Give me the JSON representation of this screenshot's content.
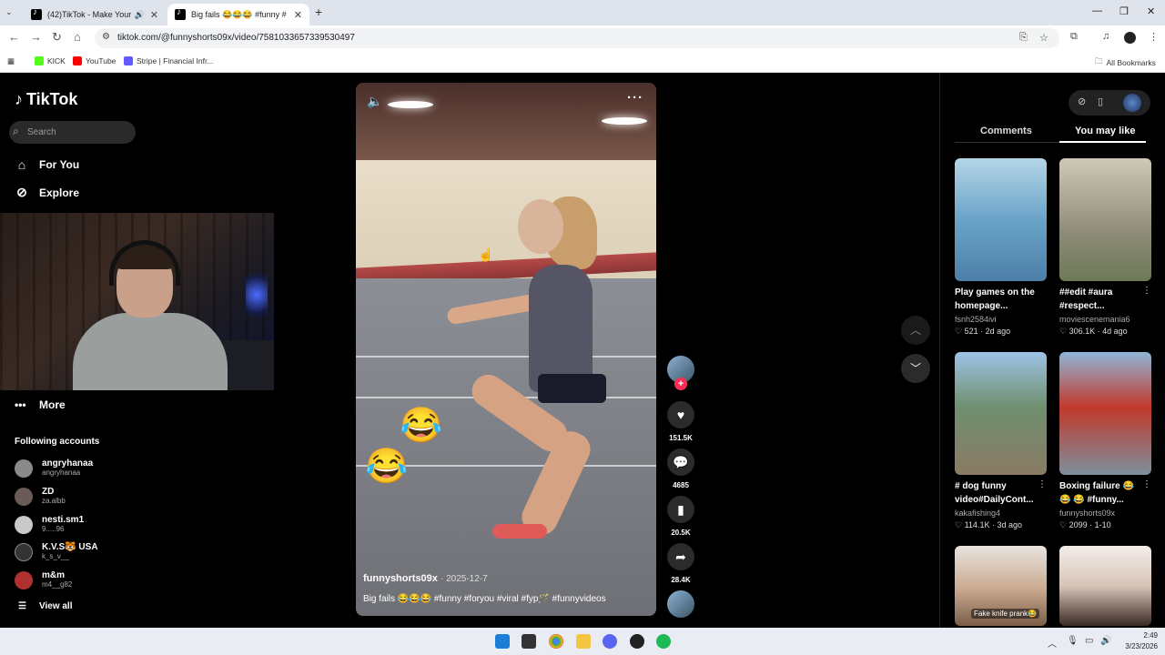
{
  "browser": {
    "tabs": [
      {
        "title": "(42)TikTok - Make Your Day",
        "active": false
      },
      {
        "title": "Big fails 😂😂😂 #funny #",
        "active": true
      }
    ],
    "url": "tiktok.com/@funnyshorts09x/video/7581033657339530497",
    "bookmarks": [
      {
        "label": "KICK",
        "color": "#53fc18"
      },
      {
        "label": "YouTube",
        "color": "#ff0000"
      },
      {
        "label": "Stripe | Financial Infr...",
        "color": "#635bff"
      }
    ],
    "all_bookmarks": "All Bookmarks"
  },
  "sidebar": {
    "logo": "TikTok",
    "search_placeholder": "Search",
    "nav": [
      {
        "label": "For You",
        "icon": "home-icon"
      },
      {
        "label": "Explore",
        "icon": "compass-icon"
      }
    ],
    "more": "More",
    "following_title": "Following accounts",
    "accounts": [
      {
        "name": "angryhanaa",
        "handle": "angryhanaa"
      },
      {
        "name": "ZD",
        "handle": "za.albb"
      },
      {
        "name": "nesti.sm1",
        "handle": "9.....96"
      },
      {
        "name": "K.V.S🐯 USA",
        "handle": "k_s_v__"
      },
      {
        "name": "m&m",
        "handle": "m4__g82"
      }
    ],
    "view_all": "View all"
  },
  "video": {
    "author": "funnyshorts09x",
    "date": "· 2025-12-7",
    "caption": "Big fails 😂😂😂 #funny #foryou #viral #fyp🪄 #funnyvideos",
    "likes": "151.5K",
    "comments": "4685",
    "saves": "20.5K",
    "shares": "28.4K"
  },
  "right_panel": {
    "tabs": [
      "Comments",
      "You may like"
    ],
    "active_tab": "You may like",
    "cards": [
      {
        "title": "Play games on the homepage...",
        "author": "fsnh2584ivi",
        "likes": "521",
        "age": "2d ago"
      },
      {
        "title": "##edit #aura #respect...",
        "author": "moviescenemania6",
        "likes": "306.1K",
        "age": "4d ago"
      },
      {
        "title": "# dog funny video#DailyCont...",
        "author": "kakafishing4",
        "likes": "114.1K",
        "age": "3d ago"
      },
      {
        "title": "Boxing failure 😂 😂 😂 #funny...",
        "author": "funnyshorts09x",
        "likes": "2099",
        "age": "1-10"
      },
      {
        "overlay": "Fake knife prank😂"
      }
    ]
  },
  "taskbar": {
    "time": "2:49",
    "date": "3/23/2026"
  }
}
